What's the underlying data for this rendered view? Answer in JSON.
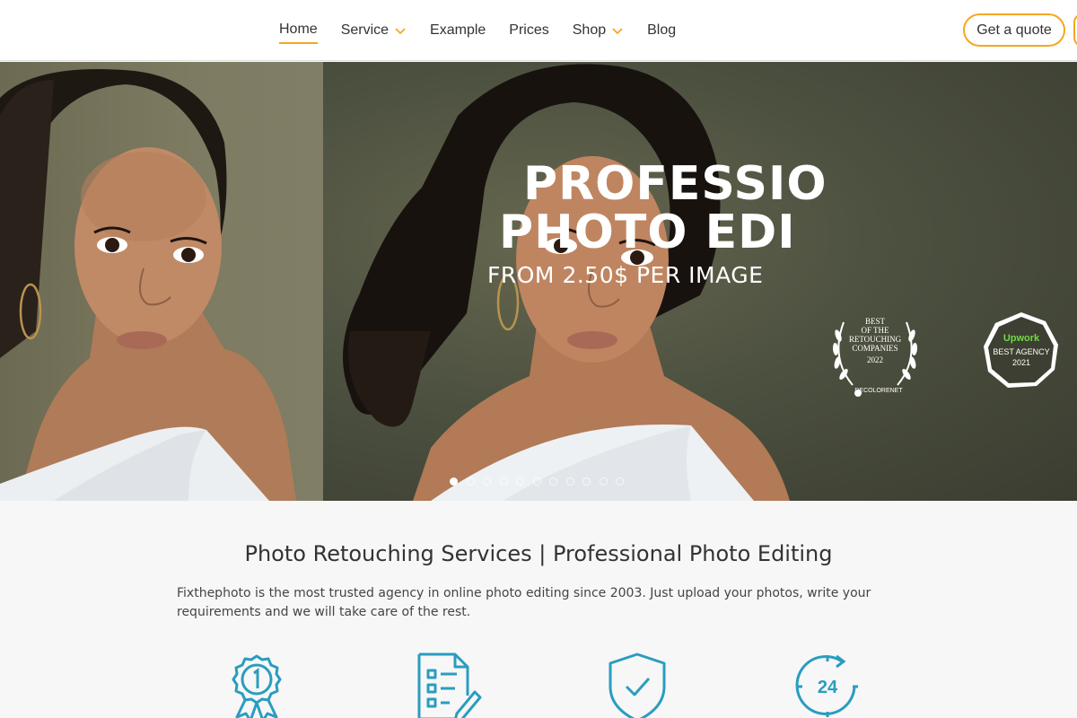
{
  "nav": {
    "items": [
      {
        "label": "Home",
        "active": true,
        "dropdown": false
      },
      {
        "label": "Service",
        "active": false,
        "dropdown": true
      },
      {
        "label": "Example",
        "active": false,
        "dropdown": false
      },
      {
        "label": "Prices",
        "active": false,
        "dropdown": false
      },
      {
        "label": "Shop",
        "active": false,
        "dropdown": true
      },
      {
        "label": "Blog",
        "active": false,
        "dropdown": false
      }
    ],
    "quote_label": "Get a quote"
  },
  "hero": {
    "title_line1": "PROFESSIO",
    "title_line2": "PHOTO EDI",
    "subtitle": "FROM 2.50$ PER IMAGE",
    "award": {
      "lines": [
        "BEST",
        "OF THE",
        "RETOUCHING",
        "COMPANIES",
        "2022"
      ],
      "brand": "DECOLORENET"
    },
    "upwork_badge": {
      "brand": "Upwork",
      "line1": "BEST AGENCY",
      "line2": "2021"
    },
    "slide_count": 11,
    "active_slide": 0
  },
  "main": {
    "title": "Photo Retouching Services | Professional Photo Editing",
    "description": "Fixthephoto is the most trusted agency in online photo editing since 2003. Just upload your photos, write your requirements and we will take care of the rest.",
    "features": [
      {
        "icon": "award-medal-icon"
      },
      {
        "icon": "checklist-document-icon"
      },
      {
        "icon": "shield-check-icon"
      },
      {
        "icon": "clock-24-icon"
      }
    ]
  },
  "colors": {
    "accent": "#f5a623",
    "icon_teal": "#2a9dbf"
  }
}
